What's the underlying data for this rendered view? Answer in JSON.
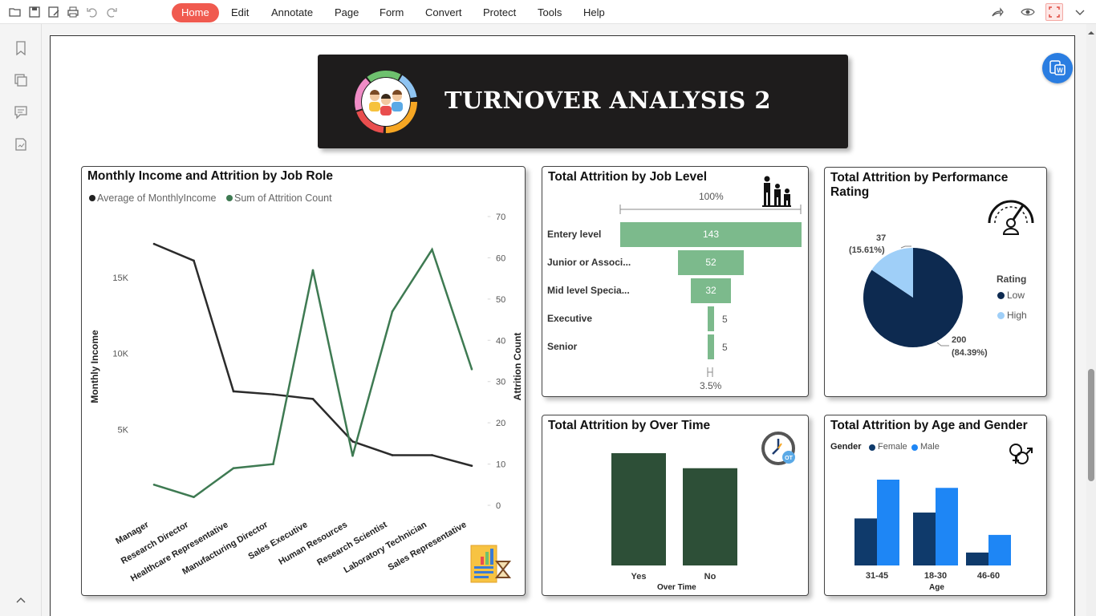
{
  "toolbar": {
    "menus": [
      "Home",
      "Edit",
      "Annotate",
      "Page",
      "Form",
      "Convert",
      "Protect",
      "Tools",
      "Help"
    ],
    "active_menu": "Home"
  },
  "banner": {
    "title": "TURNOVER ANALYSIS 2"
  },
  "colors": {
    "accent": "#f05a4f",
    "dark_green": "#2d4f37",
    "line_green": "#3e7a52",
    "navy": "#0d2a50",
    "light_blue": "#9fcff8",
    "bright_blue": "#1e86f5",
    "dark_blue": "#0f3a6b",
    "funnel_green": "#7cba8c"
  },
  "income_chart": {
    "title": "Monthly Income and Attrition by Job Role",
    "legend": [
      "Average of MonthlyIncome",
      "Sum of Attrition Count"
    ],
    "ylabel_left": "Monthly Income",
    "ylabel_right": "Attrition Count",
    "left_ticks": [
      "15K",
      "10K",
      "5K"
    ],
    "right_ticks": [
      "70",
      "60",
      "50",
      "40",
      "30",
      "20",
      "10",
      "0"
    ]
  },
  "joblevel_chart": {
    "title": "Total Attrition by Job Level",
    "top_pct": "100%",
    "bottom_pct": "3.5%"
  },
  "perf_chart": {
    "title_line1": "Total Attrition by Performance",
    "title_line2": "Rating",
    "legend_title": "Rating",
    "low_label": "Low",
    "high_label": "High",
    "high_value": "37",
    "high_pct": "(15.61%)",
    "low_value": "200",
    "low_pct": "(84.39%)"
  },
  "overtime_chart": {
    "title": "Total Attrition by Over Time",
    "xlabel": "Over Time"
  },
  "agegender_chart": {
    "title": "Total Attrition by Age and Gender",
    "legend_title": "Gender",
    "female_label": "Female",
    "male_label": "Male",
    "xlabel": "Age"
  },
  "chart_data": [
    {
      "type": "line",
      "title": "Monthly Income and Attrition by Job Role",
      "categories": [
        "Manager",
        "Research Director",
        "Healthcare Representative",
        "Manufacturing Director",
        "Sales Executive",
        "Human Resources",
        "Research Scientist",
        "Laboratory Technician",
        "Sales Representative"
      ],
      "series": [
        {
          "name": "Average of MonthlyIncome",
          "axis": "left",
          "values": [
            17200,
            16100,
            7500,
            7300,
            7000,
            4200,
            3300,
            3300,
            2600
          ]
        },
        {
          "name": "Sum of Attrition Count",
          "axis": "right",
          "values": [
            5,
            2,
            9,
            10,
            57,
            12,
            47,
            62,
            33
          ]
        }
      ],
      "ylim_left": [
        0,
        19000
      ],
      "ylim_right": [
        0,
        70
      ]
    },
    {
      "type": "bar",
      "title": "Total Attrition by Job Level",
      "categories": [
        "Entery level",
        "Junior or Associ...",
        "Mid level Specia...",
        "Executive",
        "Senior"
      ],
      "values": [
        143,
        52,
        32,
        5,
        5
      ]
    },
    {
      "type": "pie",
      "title": "Total Attrition by Performance Rating",
      "categories": [
        "Low",
        "High"
      ],
      "values": [
        200,
        37
      ]
    },
    {
      "type": "bar",
      "title": "Total Attrition by Over Time",
      "categories": [
        "Yes",
        "No"
      ],
      "values": [
        127,
        110
      ],
      "xlabel": "Over Time"
    },
    {
      "type": "bar",
      "title": "Total Attrition by Age and Gender",
      "categories": [
        "31-45",
        "18-30",
        "46-60"
      ],
      "series": [
        {
          "name": "Female",
          "values": [
            40,
            45,
            11
          ]
        },
        {
          "name": "Male",
          "values": [
            73,
            66,
            26
          ]
        }
      ],
      "xlabel": "Age"
    }
  ]
}
